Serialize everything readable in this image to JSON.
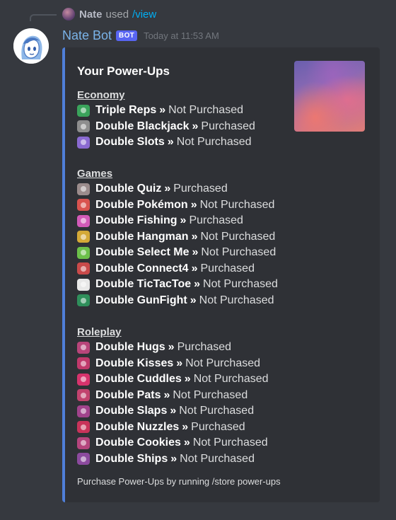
{
  "reply": {
    "name": "Nate",
    "used_text": "used",
    "command": "/view"
  },
  "author": {
    "name": "Nate Bot",
    "tag": "BOT",
    "timestamp": "Today at 11:53 AM"
  },
  "embed": {
    "title": "Your Power-Ups",
    "accent_color": "#4f7fd9",
    "separator": "»",
    "sections": [
      {
        "heading": "Economy",
        "items": [
          {
            "name": "Triple Reps",
            "status": "Not Purchased",
            "icon": "reps-icon",
            "color": "#3aa35b"
          },
          {
            "name": "Double Blackjack",
            "status": "Purchased",
            "icon": "blackjack-icon",
            "color": "#8e8e8e"
          },
          {
            "name": "Double Slots",
            "status": "Not Purchased",
            "icon": "slots-icon",
            "color": "#8a6ad1"
          }
        ]
      },
      {
        "heading": "Games",
        "items": [
          {
            "name": "Double Quiz",
            "status": "Purchased",
            "icon": "quiz-icon",
            "color": "#9b8c8c"
          },
          {
            "name": "Double Pokémon",
            "status": "Not Purchased",
            "icon": "pokemon-icon",
            "color": "#d9534f"
          },
          {
            "name": "Double Fishing",
            "status": "Purchased",
            "icon": "fishing-icon",
            "color": "#d25ab8"
          },
          {
            "name": "Double Hangman",
            "status": "Not Purchased",
            "icon": "hangman-icon",
            "color": "#d4a937"
          },
          {
            "name": "Double Select Me",
            "status": "Not Purchased",
            "icon": "select-me-icon",
            "color": "#6cc04a"
          },
          {
            "name": "Double Connect4",
            "status": "Purchased",
            "icon": "connect4-icon",
            "color": "#c94a4a"
          },
          {
            "name": "Double TicTacToe",
            "status": "Not Purchased",
            "icon": "tictactoe-icon",
            "color": "#e8e8e8"
          },
          {
            "name": "Double GunFight",
            "status": "Not Purchased",
            "icon": "gunfight-icon",
            "color": "#2f8f5b"
          }
        ]
      },
      {
        "heading": "Roleplay",
        "items": [
          {
            "name": "Double Hugs",
            "status": "Purchased",
            "icon": "hugs-icon",
            "color": "#b8457a"
          },
          {
            "name": "Double Kisses",
            "status": "Not Purchased",
            "icon": "kisses-icon",
            "color": "#c0396b"
          },
          {
            "name": "Double Cuddles",
            "status": "Not Purchased",
            "icon": "cuddles-icon",
            "color": "#d6336c"
          },
          {
            "name": "Double Pats",
            "status": "Not Purchased",
            "icon": "pats-icon",
            "color": "#c2436e"
          },
          {
            "name": "Double Slaps",
            "status": "Not Purchased",
            "icon": "slaps-icon",
            "color": "#a1438c"
          },
          {
            "name": "Double Nuzzles",
            "status": "Purchased",
            "icon": "nuzzles-icon",
            "color": "#c8335a"
          },
          {
            "name": "Double Cookies",
            "status": "Not Purchased",
            "icon": "cookies-icon",
            "color": "#b5457d"
          },
          {
            "name": "Double Ships",
            "status": "Not Purchased",
            "icon": "ships-icon",
            "color": "#8c4a9e"
          }
        ]
      }
    ],
    "footer": "Purchase Power-Ups by running /store power-ups"
  }
}
